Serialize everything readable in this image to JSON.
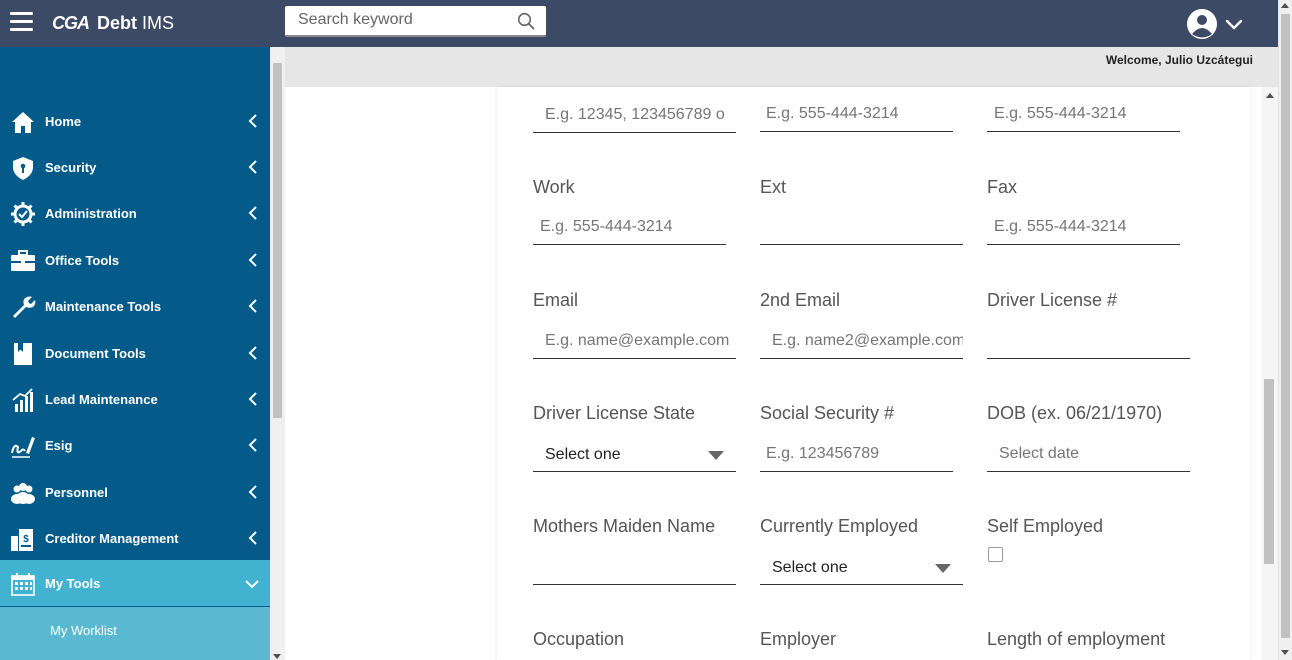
{
  "app": {
    "logo_mark": "CGA",
    "name_bold": "Debt",
    "name_rest": " IMS"
  },
  "search": {
    "placeholder": "Search keyword"
  },
  "welcome": "Welcome, Julio Uzcátegui",
  "sidebar": {
    "items": [
      {
        "label": "Home",
        "icon": "home-icon"
      },
      {
        "label": "Security",
        "icon": "shield-icon"
      },
      {
        "label": "Administration",
        "icon": "gear-check-icon"
      },
      {
        "label": "Office Tools",
        "icon": "briefcase-icon"
      },
      {
        "label": "Maintenance Tools",
        "icon": "wrench-icon"
      },
      {
        "label": "Document Tools",
        "icon": "document-icon"
      },
      {
        "label": "Lead Maintenance",
        "icon": "chart-up-icon"
      },
      {
        "label": "Esig",
        "icon": "signature-icon"
      },
      {
        "label": "Personnel",
        "icon": "people-icon"
      },
      {
        "label": "Creditor Management",
        "icon": "creditor-icon"
      },
      {
        "label": "My Tools",
        "icon": "calendar-icon"
      }
    ],
    "subitems": [
      {
        "label": "My Worklist"
      }
    ]
  },
  "form": {
    "top_row": [
      {
        "placeholder": "E.g. 12345, 123456789 o"
      },
      {
        "placeholder": "E.g. 555-444-3214"
      },
      {
        "placeholder": "E.g. 555-444-3214"
      }
    ],
    "work": {
      "label": "Work",
      "placeholder": "E.g. 555-444-3214"
    },
    "ext": {
      "label": "Ext",
      "placeholder": ""
    },
    "fax": {
      "label": "Fax",
      "placeholder": "E.g. 555-444-3214"
    },
    "email": {
      "label": "Email",
      "placeholder": "E.g. name@example.com"
    },
    "email2": {
      "label": "2nd Email",
      "placeholder": "E.g. name2@example.com"
    },
    "driver_license": {
      "label": "Driver License #",
      "placeholder": ""
    },
    "driver_license_state": {
      "label": "Driver License State",
      "value": "Select one"
    },
    "ssn": {
      "label": "Social Security #",
      "placeholder": "E.g. 123456789"
    },
    "dob": {
      "label": "DOB (ex. 06/21/1970)",
      "placeholder": "Select date"
    },
    "mothers_maiden": {
      "label": "Mothers Maiden Name",
      "placeholder": ""
    },
    "currently_employed": {
      "label": "Currently Employed",
      "value": "Select one"
    },
    "self_employed": {
      "label": "Self Employed",
      "checked": false
    },
    "occupation": {
      "label": "Occupation"
    },
    "employer": {
      "label": "Employer"
    },
    "length_employment": {
      "label": "Length of employment"
    }
  },
  "colors": {
    "topbar": "#3d4a66",
    "sidebar": "#045a89",
    "sidebar_active": "#41b2cf",
    "sidebar_sub": "#5bb8d1"
  }
}
